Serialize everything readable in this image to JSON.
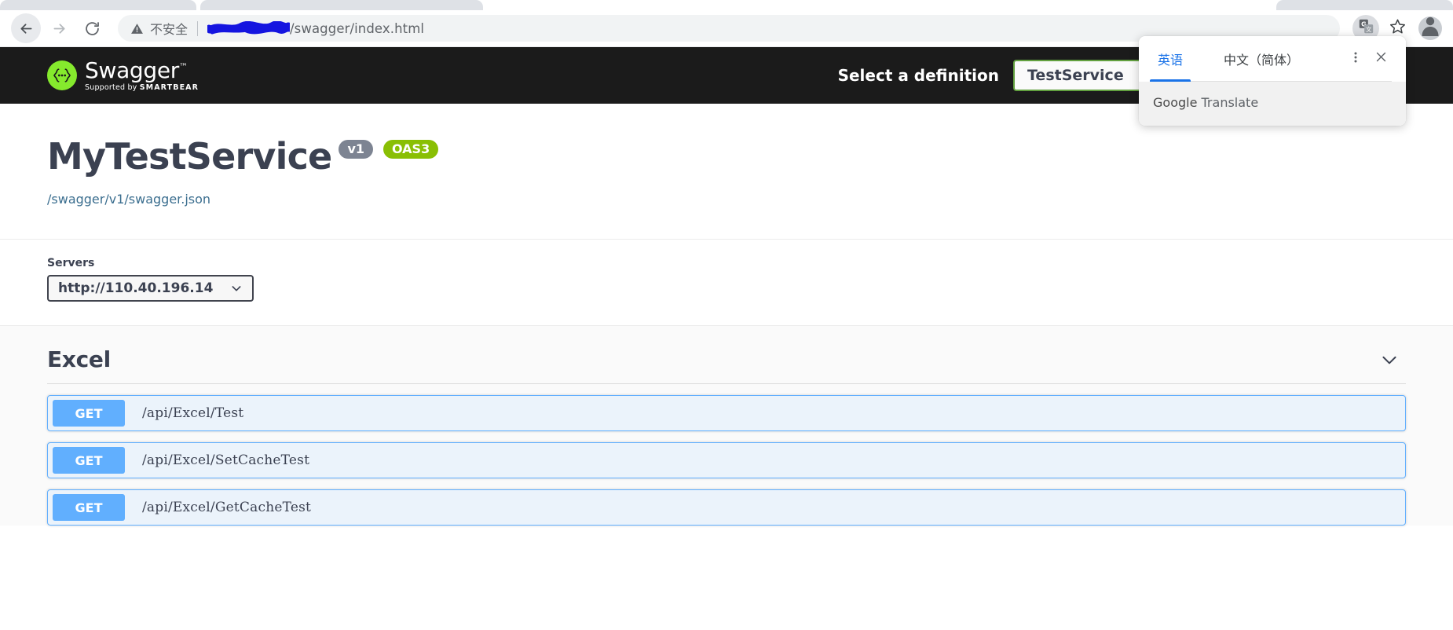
{
  "browser": {
    "nav": {
      "back": "back-arrow",
      "forward": "forward-arrow",
      "reload": "reload"
    },
    "omnibox": {
      "security_label": "不安全",
      "url_visible_suffix": "/swagger/index.html",
      "url_redacted": true
    },
    "toolbar_icons": {
      "translate": "translate-icon",
      "bookmark": "star-icon",
      "profile": "avatar-icon"
    }
  },
  "translate_popup": {
    "tabs": [
      {
        "label": "英语",
        "active": true
      },
      {
        "label": "中文（简体）",
        "active": false
      }
    ],
    "menu_icon": "kebab-menu-icon",
    "close_icon": "close-icon",
    "brand_bold": "Google",
    "brand_rest": " Translate"
  },
  "swagger": {
    "topbar": {
      "logo_name": "Swagger",
      "logo_tm": "™",
      "logo_sub_prefix": "Supported by ",
      "logo_sub_brand": "SMARTBEAR",
      "definition_label": "Select a definition",
      "definition_value": "TestService"
    },
    "info": {
      "title": "MyTestService",
      "version_badge": "v1",
      "oas_badge": "OAS3",
      "json_link": "/swagger/v1/swagger.json"
    },
    "servers": {
      "label": "Servers",
      "selected": "http://110.40.196.14"
    },
    "tags": [
      {
        "name": "Excel",
        "operations": [
          {
            "verb": "GET",
            "path": "/api/Excel/Test"
          },
          {
            "verb": "GET",
            "path": "/api/Excel/SetCacheTest"
          },
          {
            "verb": "GET",
            "path": "/api/Excel/GetCacheTest"
          }
        ]
      }
    ]
  },
  "colors": {
    "get_blue": "#61affe",
    "swagger_green": "#85ea2d",
    "oas_green": "#89bf04",
    "topbar_dark": "#1b1b1b",
    "translate_blue": "#1a73e8",
    "redaction_blue": "#1515e0"
  }
}
